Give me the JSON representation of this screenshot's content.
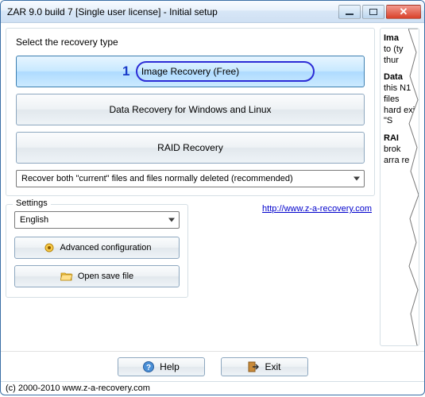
{
  "title": "ZAR 9.0 build 7 [Single user license] - Initial setup",
  "select_label": "Select the recovery type",
  "annotation_num": "1",
  "buttons": {
    "image_recovery": "Image Recovery (Free)",
    "data_recovery": "Data Recovery for Windows and Linux",
    "raid_recovery": "RAID Recovery"
  },
  "mode_dropdown": "Recover both \"current\" files and files normally deleted (recommended)",
  "settings": {
    "legend": "Settings",
    "language": "English",
    "advanced": "Advanced configuration",
    "open_save": "Open save file"
  },
  "link": "http://www.z-a-recovery.com",
  "info": {
    "p1_b": "Ima",
    "p1_rest": "to (ty thur",
    "p2_b": "Data",
    "p2_rest": "this N1 files hard exi \"S",
    "p3_b": "RAI",
    "p3_rest": "brok arra re"
  },
  "help": "Help",
  "exit": "Exit",
  "copyright": "(c) 2000-2010 www.z-a-recovery.com"
}
